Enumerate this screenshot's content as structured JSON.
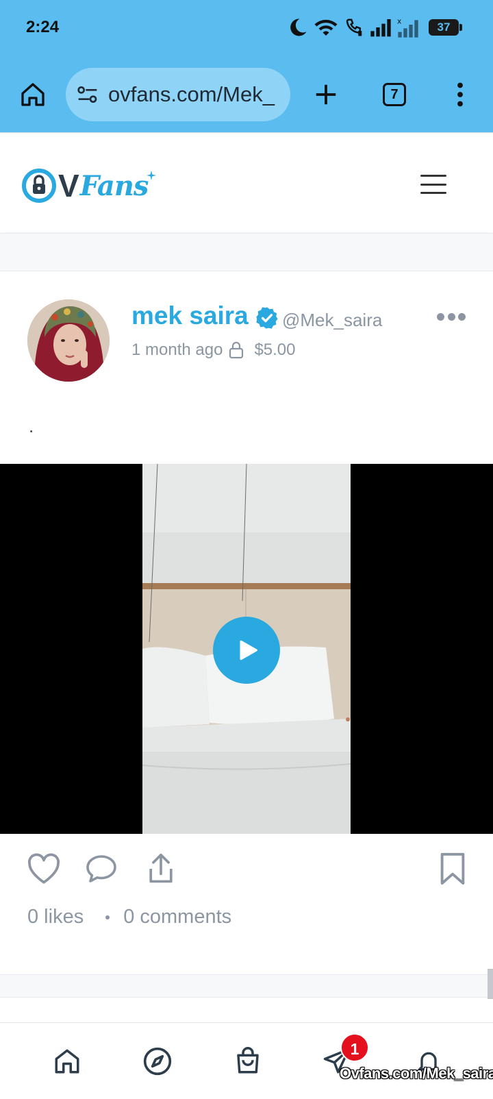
{
  "status_bar": {
    "time": "2:24",
    "battery": "37"
  },
  "browser": {
    "url": "ovfans.com/Mek_",
    "tab_count": "7"
  },
  "site": {
    "logo_v": "V",
    "logo_fans": "Fans",
    "brand_color": "#2aa8e0"
  },
  "post": {
    "author_name": "mek saira",
    "handle": "@Mek_saira",
    "posted": "1 month ago",
    "price": "$5.00",
    "text": ".",
    "likes": "0 likes",
    "comments": "0 comments"
  },
  "bottom_nav": {
    "items": [
      "home-icon",
      "explore-icon",
      "shop-icon",
      "messages-icon",
      "notifications-icon"
    ],
    "messages_badge": "1"
  },
  "watermark": "Ovfans.com/Mek_saira"
}
